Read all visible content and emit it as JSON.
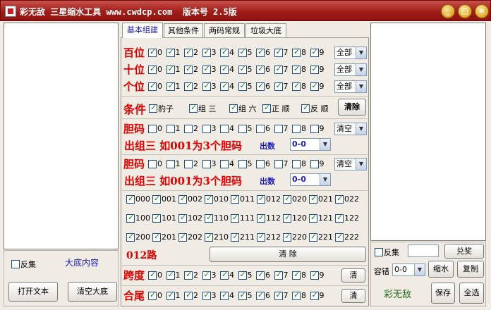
{
  "window": {
    "title": "彩无敌 三星缩水工具 www.cwdcp.com  版本号 2.5版",
    "btn_min": "_",
    "btn_max": "□",
    "btn_close": "×"
  },
  "left": {
    "fanji": "反集",
    "dadi_label": "大底内容",
    "open_text": "打开文本",
    "clear_dadi": "清空大底"
  },
  "tabs": [
    "基本组建",
    "其他条件",
    "两码常规",
    "垃圾大底"
  ],
  "digits": [
    "0",
    "1",
    "2",
    "3",
    "4",
    "5",
    "6",
    "7",
    "8",
    "9"
  ],
  "positions": {
    "bai": {
      "label": "百位",
      "checked": [
        1,
        1,
        1,
        1,
        1,
        1,
        1,
        1,
        1,
        1
      ],
      "select": "全部"
    },
    "shi": {
      "label": "十位",
      "checked": [
        1,
        1,
        1,
        1,
        1,
        1,
        1,
        1,
        1,
        1
      ],
      "select": "全部"
    },
    "ge": {
      "label": "个位",
      "checked": [
        1,
        1,
        1,
        1,
        1,
        1,
        1,
        1,
        1,
        1
      ],
      "select": "全部"
    }
  },
  "conditions": {
    "label": "条件",
    "items": [
      {
        "text": "豹子",
        "checked": 1
      },
      {
        "text": "组 三",
        "checked": 1
      },
      {
        "text": "组 六",
        "checked": 1
      },
      {
        "text": "正 顺",
        "checked": 1
      },
      {
        "text": "反 顺",
        "checked": 1
      }
    ],
    "clear": "清除"
  },
  "dan1": {
    "label": "胆码",
    "checked": [
      0,
      0,
      0,
      0,
      0,
      0,
      0,
      0,
      0,
      0
    ],
    "select": "清空",
    "desc": "出组三 如001为3个胆码",
    "count_label": "出数",
    "count": "0-0"
  },
  "dan2": {
    "label": "胆码",
    "checked": [
      0,
      0,
      0,
      0,
      0,
      0,
      0,
      0,
      0,
      0
    ],
    "select": "清空",
    "desc": "出组三 如001为3个胆码",
    "count_label": "出数",
    "count": "0-0"
  },
  "grid012": {
    "rows": [
      [
        "000",
        "001",
        "002",
        "010",
        "011",
        "012",
        "020",
        "021",
        "022"
      ],
      [
        "100",
        "101",
        "102",
        "110",
        "111",
        "112",
        "120",
        "121",
        "122"
      ],
      [
        "200",
        "201",
        "202",
        "210",
        "211",
        "212",
        "220",
        "221",
        "222"
      ]
    ],
    "label": "012路",
    "clear": "清    除"
  },
  "kuadu": {
    "label": "跨度",
    "checked": [
      1,
      1,
      1,
      1,
      1,
      1,
      1,
      1,
      1,
      1
    ],
    "clear": "清"
  },
  "hewei": {
    "label": "合尾",
    "checked": [
      1,
      1,
      1,
      1,
      1,
      1,
      1,
      1,
      1,
      1
    ],
    "clear": "清"
  },
  "right": {
    "fanji": "反集",
    "duijiang": "兑奖",
    "rongcuo": "容错",
    "rongcuo_val": "0-0",
    "suoshui": "缩水",
    "copy": "复制",
    "brand": "彩无敌",
    "save": "保存",
    "select_all": "全选"
  }
}
